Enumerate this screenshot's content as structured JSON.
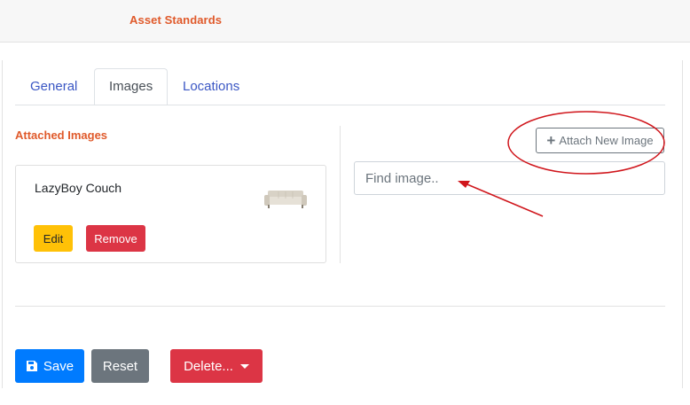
{
  "header": {
    "title": "Asset Standards"
  },
  "tabs": [
    {
      "label": "General",
      "active": false
    },
    {
      "label": "Images",
      "active": true
    },
    {
      "label": "Locations",
      "active": false
    }
  ],
  "images_section": {
    "title": "Attached Images",
    "cards": [
      {
        "name": "LazyBoy Couch",
        "thumbnail_icon": "couch-image",
        "edit_label": "Edit",
        "remove_label": "Remove"
      }
    ]
  },
  "attach": {
    "label": "Attach New Image",
    "icon": "plus-icon"
  },
  "search": {
    "placeholder": "Find image.."
  },
  "footer": {
    "save_label": "Save",
    "reset_label": "Reset",
    "delete_label": "Delete..."
  },
  "colors": {
    "accent_orange": "#e05a2b",
    "link_blue": "#3b57c4",
    "primary": "#007bff",
    "danger": "#dc3545",
    "warning": "#ffc107",
    "secondary": "#6c757d",
    "annotation_red": "#d0161c"
  }
}
